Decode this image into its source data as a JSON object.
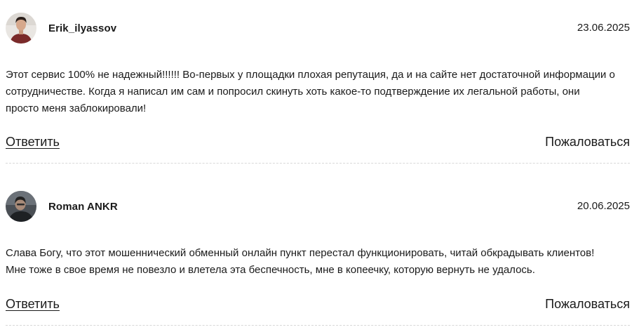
{
  "reviews": [
    {
      "username": "Erik_ilyassov",
      "date": "23.06.2025",
      "text_lines": [
        "Этот сервис 100% не надежный!!!!!! Во-первых у площадки плохая репутация, да и на сайте нет достаточной информации о",
        "сотрудничестве. Когда я написал им сам и попросил скинуть хоть какое-то подтверждение их легальной работы, они",
        "просто меня заблокировали!"
      ],
      "reply_label": "Ответить",
      "report_label": "Пожаловаться",
      "avatar_icon": "user-photo-avatar-icon"
    },
    {
      "username": "Roman ANKR",
      "date": "20.06.2025",
      "text_lines": [
        "Слава Богу, что этот мошеннический обменный онлайн пункт перестал функционировать, читай обкрадывать клиентов!",
        "Мне тоже в свое время не повезло и влетела эта беспечность, мне в копеечку, которую вернуть не удалось."
      ],
      "reply_label": "Ответить",
      "report_label": "Пожаловаться",
      "avatar_icon": "user-photo-avatar-icon"
    }
  ],
  "colors": {
    "text": "#1a1a1a",
    "divider": "#d8d8d8",
    "background": "#ffffff"
  }
}
